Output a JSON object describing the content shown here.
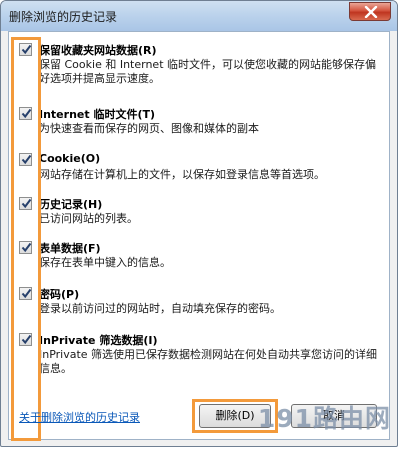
{
  "window": {
    "title": "删除浏览的历史记录"
  },
  "options": [
    {
      "label": "保留收藏夹网站数据(R)",
      "description": "保留 Cookie 和 Internet 临时文件，可以使您收藏的网站能够保存偏好选项并提高显示速度。",
      "checked": true
    },
    {
      "label": "Internet 临时文件(T)",
      "description": "为快速查看而保存的网页、图像和媒体的副本",
      "checked": true
    },
    {
      "label": "Cookie(O)",
      "description": "网站存储在计算机上的文件，以保存如登录信息等首选项。",
      "checked": true
    },
    {
      "label": "历史记录(H)",
      "description": "已访问网站的列表。",
      "checked": true
    },
    {
      "label": "表单数据(F)",
      "description": "保存在表单中键入的信息。",
      "checked": true
    },
    {
      "label": "密码(P)",
      "description": "登录以前访问过的网站时，自动填充保存的密码。",
      "checked": true
    },
    {
      "label": "InPrivate 筛选数据(I)",
      "description": "InPrivate 筛选使用已保存数据检测网站在何处自动共享您访问的详细信息。",
      "checked": true
    }
  ],
  "footer": {
    "link_text": "关于删除浏览的历史记录",
    "delete_label": "删除(D)",
    "cancel_label": "取消"
  },
  "watermark": "191路由网",
  "colors": {
    "highlight": "#f39a3b",
    "link": "#0a58b8",
    "close": "#c8412a"
  }
}
